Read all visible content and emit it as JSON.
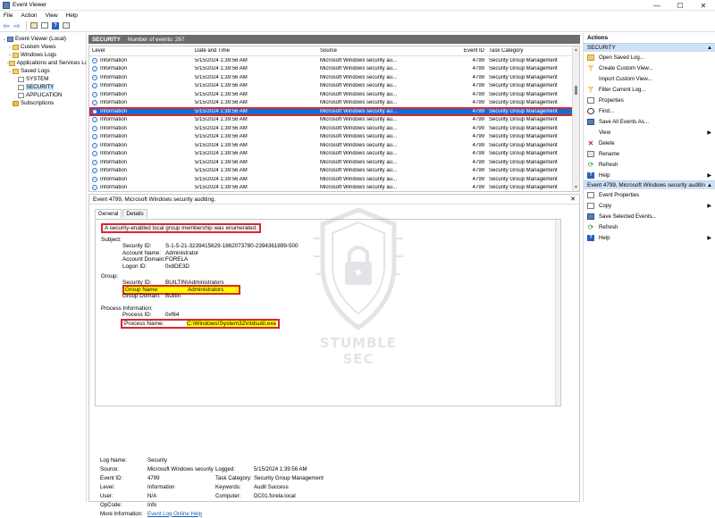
{
  "window": {
    "title": "Event Viewer",
    "minimize": "—",
    "maximize": "☐",
    "close": "✕"
  },
  "menu": [
    "File",
    "Action",
    "View",
    "Help"
  ],
  "tree": [
    {
      "label": "Event Viewer (Local)",
      "level": 0,
      "expand": "⌄",
      "icon": "event-viewer-icon"
    },
    {
      "label": "Custom Views",
      "level": 1,
      "expand": "›",
      "icon": "folder-icon"
    },
    {
      "label": "Windows Logs",
      "level": 1,
      "expand": "›",
      "icon": "folder-icon"
    },
    {
      "label": "Applications and Services Lo",
      "level": 1,
      "expand": "›",
      "icon": "folder-icon"
    },
    {
      "label": "Saved Logs",
      "level": 1,
      "expand": "⌄",
      "icon": "folder-icon"
    },
    {
      "label": "SYSTEM",
      "level": 2,
      "expand": "",
      "icon": "log-icon"
    },
    {
      "label": "SECURITY",
      "level": 2,
      "expand": "",
      "icon": "log-icon",
      "selected": true
    },
    {
      "label": "APPLICATION",
      "level": 2,
      "expand": "",
      "icon": "log-icon"
    },
    {
      "label": "Subscriptions",
      "level": 1,
      "expand": "",
      "icon": "subscription-icon"
    }
  ],
  "log": {
    "name": "SECURITY",
    "count_text": "Number of events: 267"
  },
  "columns": {
    "level": "Level",
    "date": "Date and Time",
    "source": "Source",
    "event_id": "Event ID",
    "category": "Task Category"
  },
  "events": [
    {
      "level": "Information",
      "date": "5/15/2024 1:39:56 AM",
      "source": "Microsoft Windows security au...",
      "id": "4799",
      "category": "Security Group Management"
    },
    {
      "level": "Information",
      "date": "5/15/2024 1:39:56 AM",
      "source": "Microsoft Windows security au...",
      "id": "4799",
      "category": "Security Group Management"
    },
    {
      "level": "Information",
      "date": "5/15/2024 1:39:56 AM",
      "source": "Microsoft Windows security au...",
      "id": "4799",
      "category": "Security Group Management"
    },
    {
      "level": "Information",
      "date": "5/15/2024 1:39:56 AM",
      "source": "Microsoft Windows security au...",
      "id": "4799",
      "category": "Security Group Management"
    },
    {
      "level": "Information",
      "date": "5/15/2024 1:39:56 AM",
      "source": "Microsoft Windows security au...",
      "id": "4799",
      "category": "Security Group Management"
    },
    {
      "level": "Information",
      "date": "5/15/2024 1:39:56 AM",
      "source": "Microsoft Windows security au...",
      "id": "4799",
      "category": "Security Group Management"
    },
    {
      "level": "Information",
      "date": "5/15/2024 1:39:56 AM",
      "source": "Microsoft Windows security au...",
      "id": "4799",
      "category": "Security Group Management",
      "selected": true
    },
    {
      "level": "Information",
      "date": "5/15/2024 1:39:56 AM",
      "source": "Microsoft Windows security au...",
      "id": "4799",
      "category": "Security Group Management"
    },
    {
      "level": "Information",
      "date": "5/15/2024 1:39:56 AM",
      "source": "Microsoft Windows security au...",
      "id": "4799",
      "category": "Security Group Management"
    },
    {
      "level": "Information",
      "date": "5/15/2024 1:39:56 AM",
      "source": "Microsoft Windows security au...",
      "id": "4799",
      "category": "Security Group Management"
    },
    {
      "level": "Information",
      "date": "5/15/2024 1:39:56 AM",
      "source": "Microsoft Windows security au...",
      "id": "4799",
      "category": "Security Group Management"
    },
    {
      "level": "Information",
      "date": "5/15/2024 1:39:56 AM",
      "source": "Microsoft Windows security au...",
      "id": "4799",
      "category": "Security Group Management"
    },
    {
      "level": "Information",
      "date": "5/15/2024 1:39:56 AM",
      "source": "Microsoft Windows security au...",
      "id": "4799",
      "category": "Security Group Management"
    },
    {
      "level": "Information",
      "date": "5/15/2024 1:39:56 AM",
      "source": "Microsoft Windows security au...",
      "id": "4799",
      "category": "Security Group Management"
    },
    {
      "level": "Information",
      "date": "5/15/2024 1:39:56 AM",
      "source": "Microsoft Windows security au...",
      "id": "4799",
      "category": "Security Group Management"
    },
    {
      "level": "Information",
      "date": "5/15/2024 1:39:56 AM",
      "source": "Microsoft Windows security au...",
      "id": "4799",
      "category": "Security Group Management"
    },
    {
      "level": "Information",
      "date": "5/15/2024 1:39:55 AM",
      "source": "Microsoft Windows security au...",
      "id": "4799",
      "category": "Security Group Management"
    }
  ],
  "detail": {
    "header": "Event 4799, Microsoft Windows security auditing.",
    "close": "✕",
    "tabs": [
      "General",
      "Details"
    ],
    "message": "A security-enabled local group membership was enumerated.",
    "subject_label": "Subject:",
    "subject": [
      {
        "k": "Security ID:",
        "v": "S-1-5-21-3239415629-1862073780-2394361899-500"
      },
      {
        "k": "Account Name:",
        "v": "Administrator"
      },
      {
        "k": "Account Domain:",
        "v": "FORELA"
      },
      {
        "k": "Logon ID:",
        "v": "0x8DE3D"
      }
    ],
    "group_label": "Group:",
    "group_sid": {
      "k": "Security ID:",
      "v": "BUILTIN\\Administrators"
    },
    "group_name": {
      "k": "Group Name:",
      "v": "Administrators"
    },
    "group_domain": {
      "k": "Group Domain:",
      "v": "Builtin"
    },
    "process_label": "Process Information:",
    "process_id": {
      "k": "Process ID:",
      "v": "0xf64"
    },
    "process_name": {
      "k": "Process Name:",
      "v": "C:\\Windows\\System32\\ntdsutil.exe"
    },
    "meta": {
      "log_name_k": "Log Name:",
      "log_name_v": "Security",
      "source_k": "Source:",
      "source_v": "Microsoft Windows security",
      "logged_k": "Logged:",
      "logged_v": "5/15/2024 1:39:56 AM",
      "event_id_k": "Event ID:",
      "event_id_v": "4799",
      "task_k": "Task Category:",
      "task_v": "Security Group Management",
      "level_k": "Level:",
      "level_v": "Information",
      "keywords_k": "Keywords:",
      "keywords_v": "Audit Success",
      "user_k": "User:",
      "user_v": "N/A",
      "computer_k": "Computer:",
      "computer_v": "DC01.forela.local",
      "opcode_k": "OpCode:",
      "opcode_v": "Info",
      "more_k": "More Information:",
      "more_v": "Event Log Online Help"
    }
  },
  "watermark": {
    "text": "STUMBLE SEC"
  },
  "actions": {
    "title": "Actions",
    "section1": "SECURITY",
    "items1": [
      {
        "label": "Open Saved Log...",
        "icon": "open-saved-log-icon",
        "cls": "ai-open",
        "sub": ""
      },
      {
        "label": "Create Custom View...",
        "icon": "filter-icon",
        "cls": "ai-filter",
        "sub": ""
      },
      {
        "label": "Import Custom View...",
        "icon": "blank-icon",
        "cls": "ai-plain",
        "sub": ""
      },
      {
        "label": "Filter Current Log...",
        "icon": "filter-icon",
        "cls": "ai-filter",
        "sub": ""
      },
      {
        "label": "Properties",
        "icon": "properties-icon",
        "cls": "ai-prop",
        "sub": ""
      },
      {
        "label": "Find...",
        "icon": "find-icon",
        "cls": "ai-find",
        "sub": ""
      },
      {
        "label": "Save All Events As...",
        "icon": "save-icon",
        "cls": "ai-save",
        "sub": ""
      },
      {
        "label": "View",
        "icon": "blank-icon",
        "cls": "ai-plain",
        "sub": "▶"
      },
      {
        "label": "Delete",
        "icon": "delete-icon",
        "cls": "ai-del",
        "sub": ""
      },
      {
        "label": "Rename",
        "icon": "rename-icon",
        "cls": "ai-ren",
        "sub": ""
      },
      {
        "label": "Refresh",
        "icon": "refresh-icon",
        "cls": "ai-ref",
        "sub": ""
      },
      {
        "label": "Help",
        "icon": "help-icon",
        "cls": "ai-help",
        "sub": "▶"
      }
    ],
    "section2": "Event 4799, Microsoft Windows security auditing.",
    "items2": [
      {
        "label": "Event Properties",
        "icon": "properties-icon",
        "cls": "ai-prop",
        "sub": ""
      },
      {
        "label": "Copy",
        "icon": "copy-icon",
        "cls": "ai-copy",
        "sub": "▶"
      },
      {
        "label": "Save Selected Events...",
        "icon": "save-icon",
        "cls": "ai-save",
        "sub": ""
      },
      {
        "label": "Refresh",
        "icon": "refresh-icon",
        "cls": "ai-ref",
        "sub": ""
      },
      {
        "label": "Help",
        "icon": "help-icon",
        "cls": "ai-help",
        "sub": "▶"
      }
    ]
  },
  "colors": {
    "selection": "#0b6fd8",
    "highlight_border": "#e0242a",
    "highlight_fill": "#ffff00",
    "section_bg": "#cfe1f4"
  }
}
